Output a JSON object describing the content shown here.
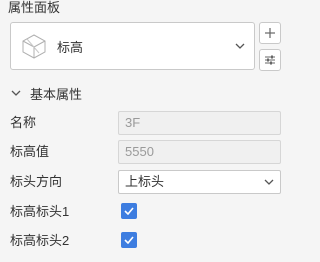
{
  "panel": {
    "title": "属性面板"
  },
  "type_selector": {
    "label": "标高"
  },
  "section": {
    "label": "基本属性"
  },
  "properties": {
    "name": {
      "label": "名称",
      "value": "3F"
    },
    "elevation": {
      "label": "标高值",
      "value": "5550"
    },
    "head_direction": {
      "label": "标头方向",
      "value": "上标头"
    },
    "head1": {
      "label": "标高标头1",
      "checked": true
    },
    "head2": {
      "label": "标高标头2",
      "checked": true
    }
  },
  "colors": {
    "accent": "#3d7de0",
    "border": "#c9c9c9",
    "background": "#f5f5f5"
  }
}
